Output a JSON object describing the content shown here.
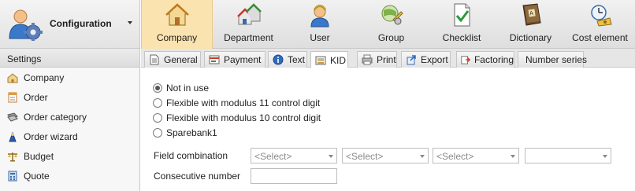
{
  "app": {
    "title": "Configuration"
  },
  "sidebar": {
    "header": "Settings",
    "items": [
      {
        "label": "Company",
        "icon": "house-icon"
      },
      {
        "label": "Order",
        "icon": "order-icon"
      },
      {
        "label": "Order category",
        "icon": "order-category-icon"
      },
      {
        "label": "Order wizard",
        "icon": "wizard-icon"
      },
      {
        "label": "Budget",
        "icon": "scales-icon"
      },
      {
        "label": "Quote",
        "icon": "calculator-icon"
      }
    ]
  },
  "ribbon": {
    "buttons": [
      {
        "label": "Company",
        "icon": "house-icon",
        "active": true
      },
      {
        "label": "Department",
        "icon": "buildings-icon",
        "active": false
      },
      {
        "label": "User",
        "icon": "user-icon",
        "active": false
      },
      {
        "label": "Group",
        "icon": "group-icon",
        "active": false
      },
      {
        "label": "Checklist",
        "icon": "checklist-icon",
        "active": false
      },
      {
        "label": "Dictionary",
        "icon": "dictionary-icon",
        "active": false
      },
      {
        "label": "Cost element",
        "icon": "cost-element-icon",
        "active": false
      }
    ]
  },
  "tabs": [
    {
      "label": "General",
      "icon": "document-icon",
      "active": false
    },
    {
      "label": "Payment",
      "icon": "payment-icon",
      "active": false
    },
    {
      "label": "Text",
      "icon": "info-icon",
      "active": false
    },
    {
      "label": "KID",
      "icon": "kid-icon",
      "active": true
    },
    {
      "label": "Print",
      "icon": "printer-icon",
      "active": false
    },
    {
      "label": "Export",
      "icon": "export-icon",
      "active": false
    },
    {
      "label": "Factoring",
      "icon": "factoring-icon",
      "active": false
    },
    {
      "label": "Number series",
      "icon": "",
      "active": false
    }
  ],
  "kid": {
    "options": [
      {
        "label": "Not in use",
        "checked": true
      },
      {
        "label": "Flexible with modulus 11 control digit",
        "checked": false
      },
      {
        "label": "Flexible with modulus 10 control digit",
        "checked": false
      },
      {
        "label": "Sparebank1",
        "checked": false
      }
    ],
    "field_combination_label": "Field combination",
    "field_combination_selects": [
      "<Select>",
      "<Select>",
      "<Select>",
      ""
    ],
    "consecutive_number_label": "Consecutive number",
    "consecutive_number_value": ""
  },
  "colors": {
    "active_ribbon": "#fbe3b0",
    "panel_bg": "#f7f7f7"
  }
}
